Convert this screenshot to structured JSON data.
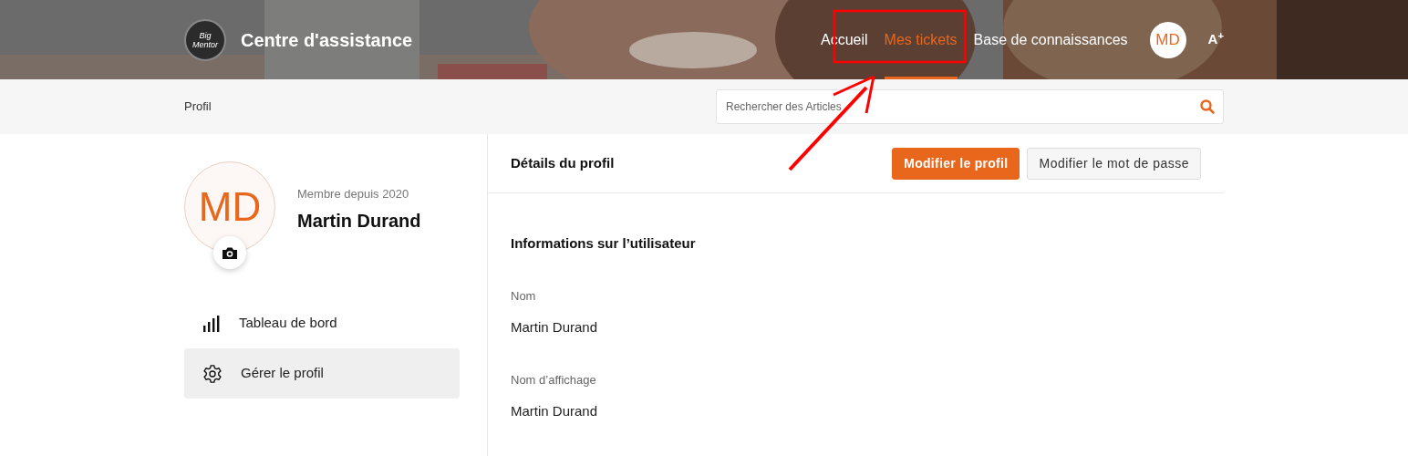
{
  "header": {
    "logo_text": "Big Mentor",
    "title": "Centre d'assistance",
    "nav": [
      {
        "label": "Accueil",
        "selected": false
      },
      {
        "label": "Mes tickets",
        "selected": true
      },
      {
        "label": "Base de connaissances",
        "selected": false
      }
    ],
    "avatar": "MD",
    "text_size": "A$^{+}$"
  },
  "breadcrumb": "Profil",
  "search": {
    "placeholder": "Rechercher des Articles"
  },
  "profile": {
    "initials": "MD",
    "member_since": "Membre depuis 2020",
    "name": "Martin Durand"
  },
  "sidebar": {
    "items": [
      {
        "label": "Tableau de bord",
        "kind": "chart",
        "selected": false
      },
      {
        "label": "Gérer le profil",
        "kind": "gear",
        "selected": true
      }
    ]
  },
  "details": {
    "title": "Détails du profil",
    "buttons": [
      {
        "label": "Modifier le profil",
        "kind": "primary"
      },
      {
        "label": "Modifier le mot de passe",
        "kind": "secondary"
      }
    ],
    "section_title": "Informations sur l’utilisateur",
    "fields": [
      {
        "label": "Nom",
        "value": "Martin Durand"
      },
      {
        "label": "Nom d’affichage",
        "value": "Martin Durand"
      }
    ]
  }
}
